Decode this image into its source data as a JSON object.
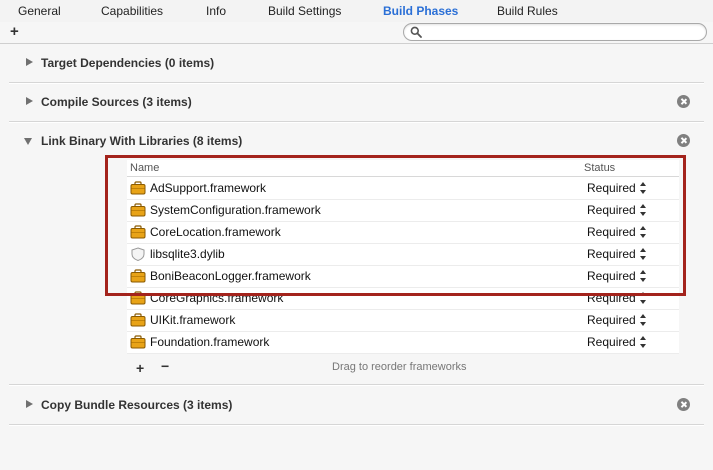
{
  "tabs": [
    {
      "label": "General"
    },
    {
      "label": "Capabilities"
    },
    {
      "label": "Info"
    },
    {
      "label": "Build Settings"
    },
    {
      "label": "Build Phases"
    },
    {
      "label": "Build Rules"
    }
  ],
  "active_tab": "Build Phases",
  "toolbar": {
    "add_label": "+",
    "search_value": "",
    "search_placeholder": ""
  },
  "sections": [
    {
      "title": "Target Dependencies (0 items)",
      "expanded": false,
      "removable": false
    },
    {
      "title": "Compile Sources (3 items)",
      "expanded": false,
      "removable": true
    },
    {
      "title": "Link Binary With Libraries (8 items)",
      "expanded": true,
      "removable": true
    },
    {
      "title": "Copy Bundle Resources (3 items)",
      "expanded": false,
      "removable": true
    }
  ],
  "libraries": {
    "columns": {
      "name": "Name",
      "status": "Status"
    },
    "rows": [
      {
        "name": "AdSupport.framework",
        "status": "Required",
        "icon": "framework-icon"
      },
      {
        "name": "SystemConfiguration.framework",
        "status": "Required",
        "icon": "framework-icon"
      },
      {
        "name": "CoreLocation.framework",
        "status": "Required",
        "icon": "framework-icon"
      },
      {
        "name": "libsqlite3.dylib",
        "status": "Required",
        "icon": "dylib-icon"
      },
      {
        "name": "BoniBeaconLogger.framework",
        "status": "Required",
        "icon": "framework-icon"
      },
      {
        "name": "CoreGraphics.framework",
        "status": "Required",
        "icon": "framework-icon"
      },
      {
        "name": "UIKit.framework",
        "status": "Required",
        "icon": "framework-icon"
      },
      {
        "name": "Foundation.framework",
        "status": "Required",
        "icon": "framework-icon"
      }
    ],
    "add_label": "+",
    "remove_label": "−",
    "drag_hint": "Drag to reorder frameworks"
  },
  "colors": {
    "active_tab": "#2a6fd6",
    "highlight": "#a3231c",
    "framework_icon": "#e8a317"
  }
}
